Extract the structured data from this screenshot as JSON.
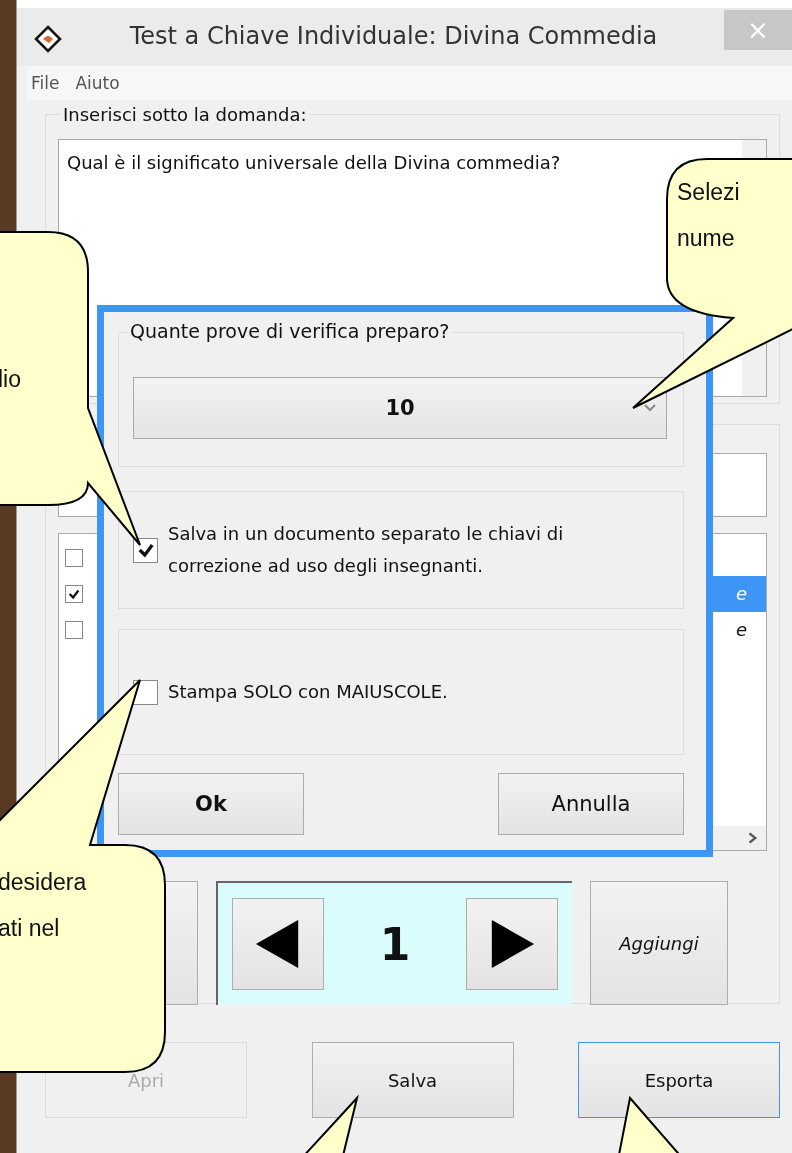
{
  "window": {
    "title": "Test a Chiave Individuale: Divina Commedia",
    "close": "×"
  },
  "menu": [
    "File",
    "Aiuto"
  ],
  "question_group": {
    "legend": "Inserisci sotto la domanda:",
    "value": "Qual è il significato universale della Divina commedia?"
  },
  "answers_list": [
    {
      "checked": false,
      "selected": false
    },
    {
      "text": "e",
      "checked": true,
      "selected": true
    },
    {
      "text": "e",
      "checked": false,
      "selected": false
    }
  ],
  "navigator": {
    "page": "1"
  },
  "side_buttons": [
    "Aggiungi"
  ],
  "bottom_buttons": [
    {
      "label": "Apri",
      "disabled": true,
      "focused": false
    },
    {
      "label": "Salva",
      "disabled": false,
      "focused": false
    },
    {
      "label": "Esporta",
      "disabled": false,
      "focused": true
    }
  ],
  "dialog": {
    "question": "Quante prove di verifica preparo?",
    "count": "10",
    "options": [
      {
        "label": "Salva in un documento separato le chiavi di correzione ad uso degli insegnanti.",
        "checked": true
      },
      {
        "label": "Stampa SOLO con MAIUSCOLE.",
        "checked": false
      }
    ],
    "buttons": [
      "Ok",
      "Annulla"
    ]
  },
  "callouts": [
    {
      "lines": [
        "lio"
      ]
    },
    {
      "lines": [
        "Selezi",
        "nume"
      ]
    },
    {
      "lines": [
        "desidera",
        "ati nel"
      ]
    }
  ]
}
